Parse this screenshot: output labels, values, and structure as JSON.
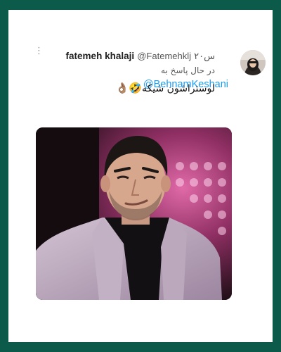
{
  "tweet": {
    "author_name": "fatemeh khalaji",
    "author_handle": "@Fatemehklj",
    "time": "۲۰س",
    "reply_prefix": "در حال پاسخ به",
    "reply_to": "@BehnamKeshani",
    "text": "لوستراشون شیکه",
    "emojis": "🤣👌🏽",
    "more_icon": "⋮"
  },
  "colors": {
    "frame": "#0c5a49",
    "link": "#1d9bf0",
    "jacket": "#b8a3bb",
    "backdrop": "#c24a8c"
  },
  "icons": {
    "more": "vertical-ellipsis-icon",
    "avatar": "profile-photo",
    "media": "man-in-light-jacket-photo"
  }
}
